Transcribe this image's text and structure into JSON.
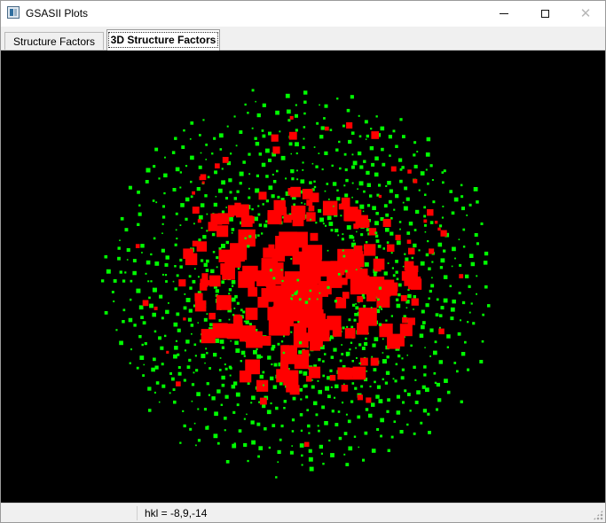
{
  "window": {
    "title": "GSASII Plots",
    "icon": "gsas-app-icon",
    "controls": [
      "minimize",
      "maximize",
      "close"
    ]
  },
  "tabs": [
    {
      "label": "Structure Factors",
      "selected": false
    },
    {
      "label": "3D Structure Factors",
      "selected": true
    }
  ],
  "plot": {
    "type": "3D reciprocal lattice structure factor view",
    "background": "#000000",
    "observed_color": "#00ff00",
    "calculated_color": "#ff0000"
  },
  "status": {
    "text": "hkl = -8,9,-14"
  }
}
